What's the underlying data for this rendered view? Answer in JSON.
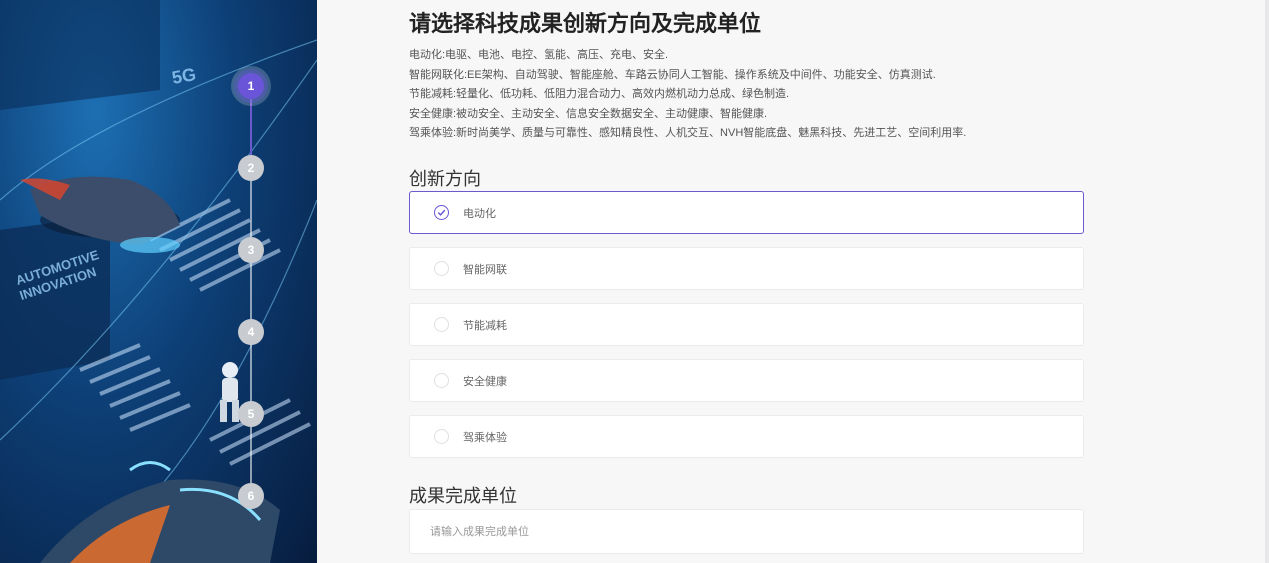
{
  "hero": {
    "sign_text_1": "AUTOMOTIVE",
    "sign_text_2": "INNOVATION",
    "label_5g": "5G"
  },
  "stepper": {
    "steps": [
      "1",
      "2",
      "3",
      "4",
      "5",
      "6"
    ],
    "active": "1"
  },
  "page_title": "请选择科技成果创新方向及完成单位",
  "description_lines": [
    "电动化:电驱、电池、电控、氢能、高压、充电、安全.",
    "智能网联化:EE架构、自动驾驶、智能座舱、车路云协同人工智能、操作系统及中间件、功能安全、仿真测试.",
    "节能减耗:轻量化、低功耗、低阻力混合动力、高效内燃机动力总成、绿色制造.",
    "安全健康:被动安全、主动安全、信息安全数据安全、主动健康、智能健康.",
    "驾乘体验:新时尚美学、质量与可靠性、感知精良性、人机交互、NVH智能底盘、魅黑科技、先进工艺、空间利用率."
  ],
  "direction_section": {
    "title": "创新方向",
    "options": [
      "电动化",
      "智能网联",
      "节能减耗",
      "安全健康",
      "驾乘体验"
    ],
    "selected": "电动化"
  },
  "unit_section": {
    "title": "成果完成单位",
    "placeholder": "请输入成果完成单位"
  },
  "colors": {
    "accent": "#6a55d8",
    "hero_dark": "#071c3e"
  }
}
